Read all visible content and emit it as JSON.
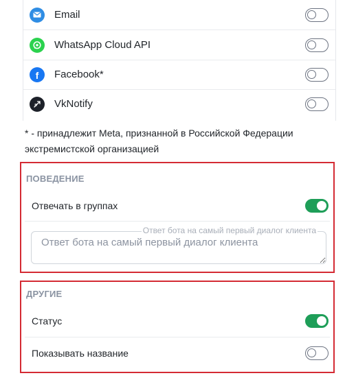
{
  "channels": [
    {
      "label": "Email",
      "icon": "email-icon",
      "color": "#2f8de4",
      "enabled": false
    },
    {
      "label": "WhatsApp Cloud API",
      "icon": "whatsapp-icon",
      "color": "#2bd24e",
      "enabled": false
    },
    {
      "label": "Facebook*",
      "icon": "facebook-icon",
      "color": "#1877f2",
      "enabled": false
    },
    {
      "label": "VkNotify",
      "icon": "vknotify-icon",
      "color": "#1d2129",
      "enabled": false
    }
  ],
  "meta_note": "* - принадлежит Meta, признанной в Российской Федерации экстремистской организацией",
  "behavior": {
    "title": "ПОВЕДЕНИЕ",
    "reply_in_groups_label": "Отвечать в группах",
    "reply_in_groups_enabled": true,
    "first_reply_label": "Ответ бота на самый первый диалог клиента",
    "first_reply_placeholder": "Ответ бота на самый первый диалог клиента",
    "first_reply_value": ""
  },
  "other": {
    "title": "ДРУГИЕ",
    "status_label": "Статус",
    "status_enabled": true,
    "show_name_label": "Показывать название",
    "show_name_enabled": false
  },
  "colors": {
    "accent_green": "#1e9e58",
    "highlight_red": "#d42a33",
    "section_title": "#8a93a2"
  }
}
